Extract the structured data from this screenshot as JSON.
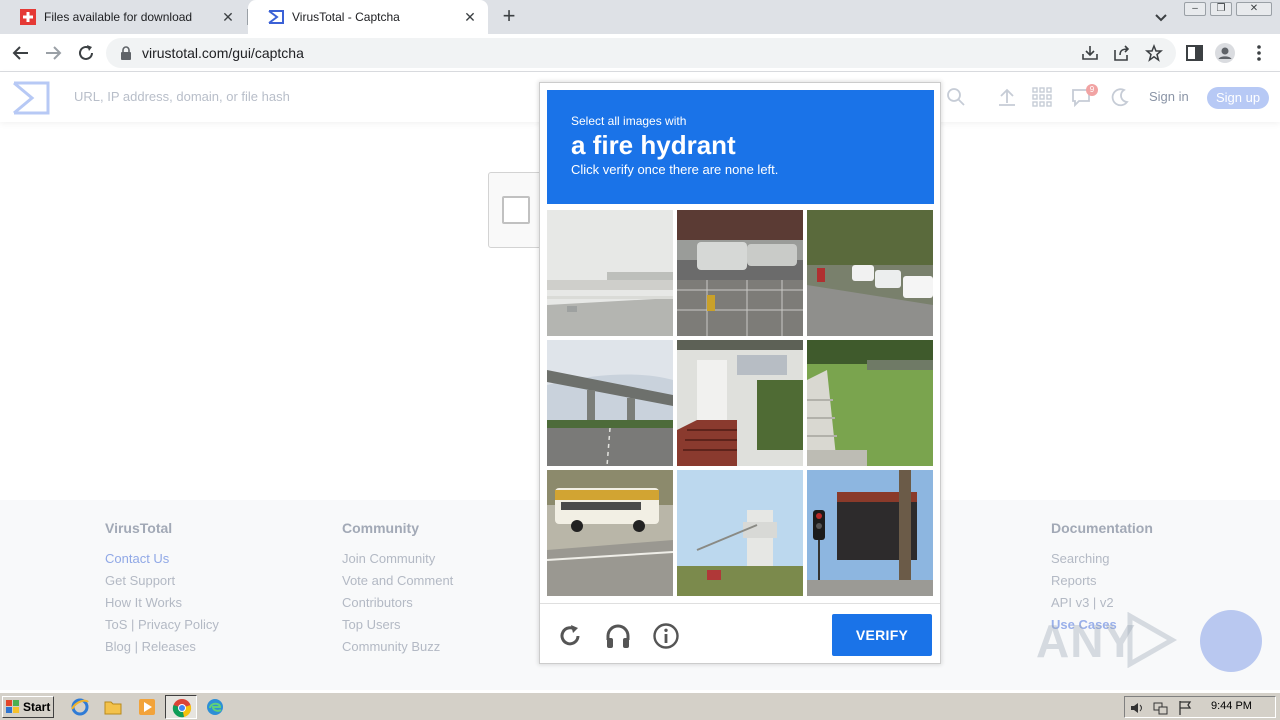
{
  "browser": {
    "tabs": [
      {
        "title": "Files available for download",
        "favicon": "swiss-cross-icon",
        "active": false
      },
      {
        "title": "VirusTotal - Captcha",
        "favicon": "virustotal-logo-icon",
        "active": true
      }
    ],
    "url": "virustotal.com/gui/captcha",
    "toolbar_icons": [
      "back-icon",
      "forward-icon",
      "reload-icon",
      "lock-icon",
      "install-icon",
      "share-icon",
      "bookmark-star-icon",
      "side-panel-icon",
      "profile-icon",
      "menu-icon"
    ]
  },
  "vt_header": {
    "search_placeholder": "URL, IP address, domain, or file hash",
    "notification_count": "9",
    "signin_label": "Sign in",
    "signup_label": "Sign up"
  },
  "footer": {
    "columns": [
      {
        "title": "VirusTotal",
        "links": [
          "Contact Us",
          "Get Support",
          "How It Works",
          "ToS | Privacy Policy",
          "Blog | Releases"
        ]
      },
      {
        "title": "Community",
        "links": [
          "Join Community",
          "Vote and Comment",
          "Contributors",
          "Top Users",
          "Community Buzz"
        ]
      },
      {
        "title": "Documentation",
        "links": [
          "Searching",
          "Reports",
          "API v3 | v2",
          "Use Cases"
        ]
      }
    ]
  },
  "captcha": {
    "instruction_small": "Select all images with",
    "target": "a fire hydrant",
    "hint": "Click verify once there are none left.",
    "tiles": [
      "highway-overpass-haze",
      "parking-lot-cars",
      "street-parked-cars",
      "elevated-highway-road",
      "house-red-stairs",
      "concrete-steps-lawn",
      "school-bus",
      "water-tower-field",
      "traffic-light-building"
    ],
    "footer_icons": [
      "reload-icon",
      "audio-headphones-icon",
      "info-icon"
    ],
    "verify_label": "VERIFY",
    "colors": {
      "header": "#1a73e8",
      "button": "#1a73e8"
    }
  },
  "watermark": {
    "text": "ANY"
  },
  "taskbar": {
    "start_label": "Start",
    "clock": "9:44 PM"
  }
}
